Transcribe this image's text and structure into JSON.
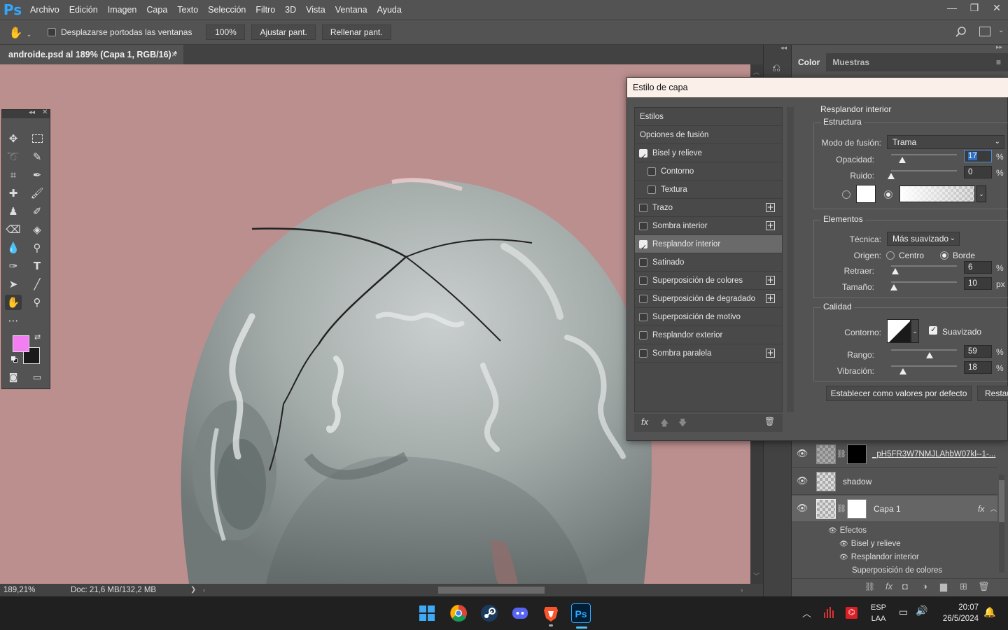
{
  "app": {
    "logo": "Ps"
  },
  "menu": [
    "Archivo",
    "Edición",
    "Imagen",
    "Capa",
    "Texto",
    "Selección",
    "Filtro",
    "3D",
    "Vista",
    "Ventana",
    "Ayuda"
  ],
  "window_controls": {
    "minimize": "—",
    "restore": "❐",
    "close": "✕"
  },
  "options": {
    "scroll_all_label": "Desplazarse portodas las ventanas",
    "zoom_100": "100%",
    "fit_screen": "Ajustar pant.",
    "fill_screen": "Rellenar pant."
  },
  "document": {
    "tab_title": "androide.psd al 189% (Capa 1, RGB/16) *",
    "close": "×"
  },
  "status": {
    "zoom": "189,21%",
    "doc_size": "Doc: 21,6 MB/132,2 MB",
    "arrow": "❯"
  },
  "panels": {
    "tabs": [
      "Color",
      "Muestras"
    ]
  },
  "colors": {
    "foreground": "#f27ef1",
    "background": "#1a1a1a",
    "canvas_bg": "#bc8f8f"
  },
  "dialog": {
    "title": "Estilo de capa",
    "styles_header": "Estilos",
    "blend_options": "Opciones de fusión",
    "styles": [
      {
        "label": "Bisel y relieve",
        "checked": true,
        "indent": false,
        "plus": false,
        "selected": false
      },
      {
        "label": "Contorno",
        "checked": false,
        "indent": true,
        "plus": false,
        "selected": false
      },
      {
        "label": "Textura",
        "checked": false,
        "indent": true,
        "plus": false,
        "selected": false
      },
      {
        "label": "Trazo",
        "checked": false,
        "indent": false,
        "plus": true,
        "selected": false
      },
      {
        "label": "Sombra interior",
        "checked": false,
        "indent": false,
        "plus": true,
        "selected": false
      },
      {
        "label": "Resplandor interior",
        "checked": true,
        "indent": false,
        "plus": false,
        "selected": true
      },
      {
        "label": "Satinado",
        "checked": false,
        "indent": false,
        "plus": false,
        "selected": false
      },
      {
        "label": "Superposición de colores",
        "checked": false,
        "indent": false,
        "plus": true,
        "selected": false
      },
      {
        "label": "Superposición de degradado",
        "checked": false,
        "indent": false,
        "plus": true,
        "selected": false
      },
      {
        "label": "Superposición de motivo",
        "checked": false,
        "indent": false,
        "plus": false,
        "selected": false
      },
      {
        "label": "Resplandor exterior",
        "checked": false,
        "indent": false,
        "plus": false,
        "selected": false
      },
      {
        "label": "Sombra paralela",
        "checked": false,
        "indent": false,
        "plus": true,
        "selected": false
      }
    ],
    "footer_fx": "fx",
    "section_title": "Resplandor interior",
    "structure": {
      "title": "Estructura",
      "blend_mode_label": "Modo de fusión:",
      "blend_mode": "Trama",
      "opacity_label": "Opacidad:",
      "opacity": "17",
      "opacity_level": 0.17,
      "noise_label": "Ruido:",
      "noise": "0",
      "noise_level": 0,
      "percent": "%"
    },
    "elements": {
      "title": "Elementos",
      "technique_label": "Técnica:",
      "technique": "Más suavizado",
      "source_label": "Origen:",
      "center": "Centro",
      "edge": "Borde",
      "choke_label": "Retraer:",
      "choke": "6",
      "choke_level": 0.06,
      "size_label": "Tamaño:",
      "size": "10",
      "size_level": 0.04,
      "px": "px"
    },
    "quality": {
      "title": "Calidad",
      "contour_label": "Contorno:",
      "antialias": "Suavizado",
      "range_label": "Rango:",
      "range": "59",
      "range_level": 0.59,
      "jitter_label": "Vibración:",
      "jitter": "18",
      "jitter_level": 0.18
    },
    "buttons": {
      "set_default": "Establecer como valores por defecto",
      "reset": "Restau"
    }
  },
  "layers": {
    "rows": [
      {
        "name": "_pH5FR3W7NMJLAhbW07kl--1-..."
      },
      {
        "name": "shadow"
      },
      {
        "name": "Capa 1",
        "fx": "fx"
      }
    ],
    "effects_label": "Efectos",
    "effects": [
      "Bisel y relieve",
      "Resplandor interior",
      "Superposición de colores"
    ]
  },
  "taskbar": {
    "lang": "ESP",
    "layout": "LAA",
    "time": "20:07",
    "date": "26/5/2024",
    "apps": [
      "windows-start",
      "chrome",
      "steam",
      "discord",
      "brave",
      "photoshop"
    ]
  }
}
